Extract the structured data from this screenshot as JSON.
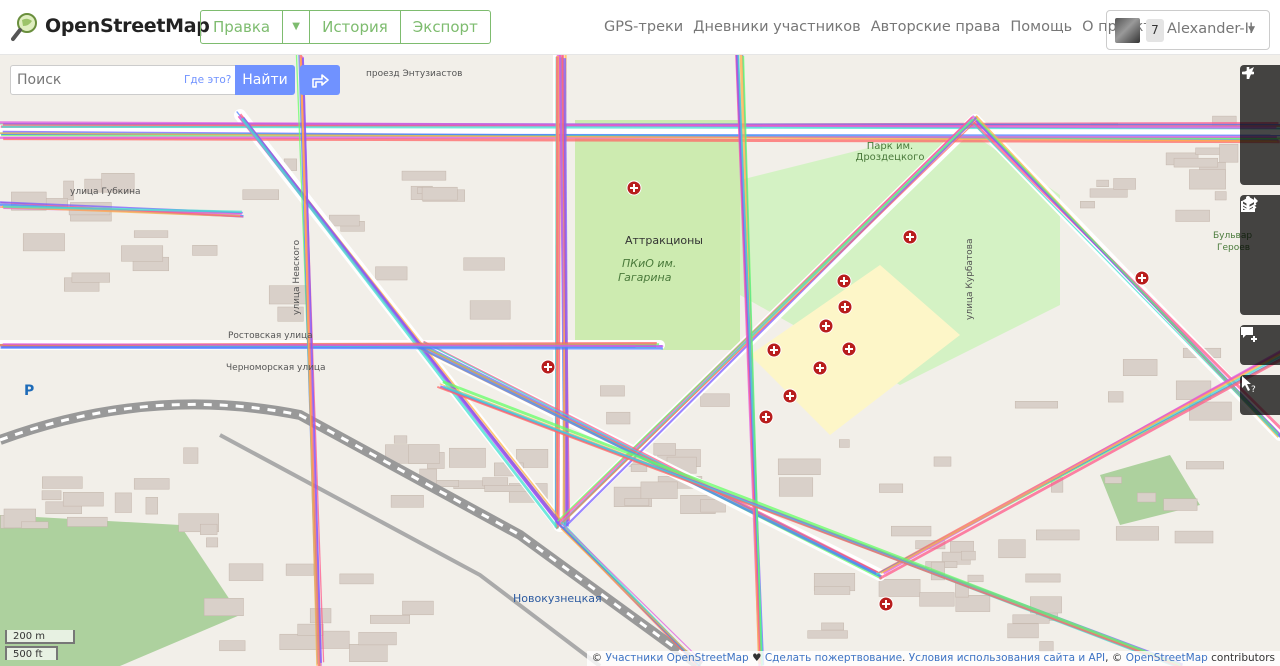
{
  "header": {
    "logo_text": "OpenStreetMap",
    "edit_button": "Правка",
    "history_button": "История",
    "export_button": "Экспорт",
    "nav": [
      "GPS-треки",
      "Дневники участников",
      "Авторские права",
      "Помощь",
      "О проекте"
    ],
    "user": {
      "badge": "7",
      "name": "Alexander-II"
    }
  },
  "search": {
    "placeholder": "Поиск",
    "where_link": "Где это?",
    "go_button": "Найти"
  },
  "map_labels": {
    "street_top": "проезд Энтузиастов",
    "park_drozd": "Парк им. Дроздецкого",
    "attractions": "Аттракционы",
    "pkio_1": "ПКиО им.",
    "pkio_2": "Гагарина",
    "gubkina": "улица Губкина",
    "rostov": "Ростовская улица",
    "chernomor": "Черноморская улица",
    "nevskogo": "улица Невского",
    "kurbatova": "улица Курбатова",
    "bulvar_1": "Бульвар",
    "bulvar_2": "Героев",
    "novokuz": "Новокузнецкая",
    "parking": "P"
  },
  "scale": {
    "metric": "200 m",
    "imperial": "500 ft"
  },
  "attribution": {
    "prefix": "© ",
    "contributors": "Участники OpenStreetMap",
    "heart": " ♥ ",
    "donate": "Сделать пожертвование",
    "sep": ". ",
    "terms": "Условия использования сайта и API",
    "comma": ", © ",
    "osm": "OpenStreetMap",
    "suffix": " contributors"
  },
  "colors": {
    "accent_green": "#7ebc6f",
    "accent_blue": "#7092ff",
    "map_bg": "#f2efe9",
    "park": "#c8facc",
    "hospital_marker": "#b81d1d"
  },
  "icons": [
    "zoom-in-icon",
    "zoom-out-icon",
    "geolocate-icon",
    "layers-icon",
    "info-icon",
    "share-icon",
    "note-icon",
    "query-icon",
    "directions-icon",
    "magnifier-logo-icon",
    "hospital-icon"
  ]
}
